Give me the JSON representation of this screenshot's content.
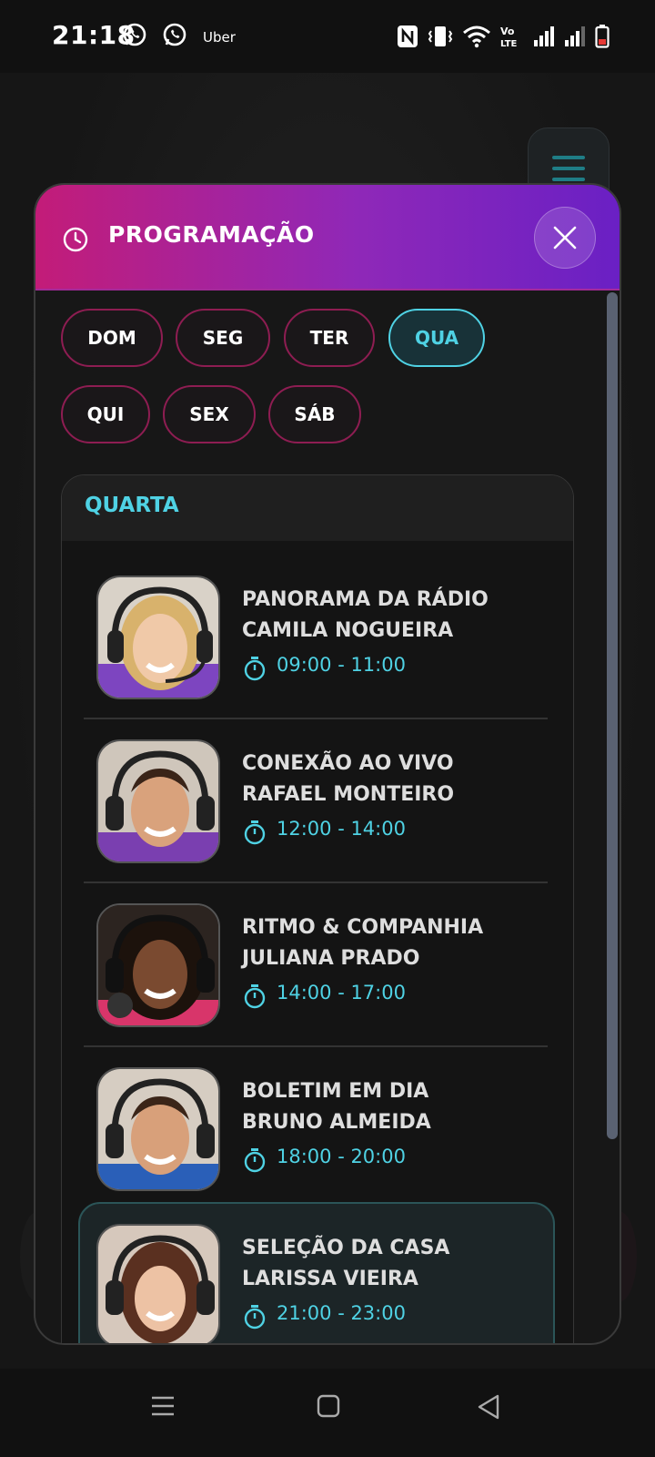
{
  "status_bar": {
    "time": "21:18",
    "notifications": [
      "whatsapp-icon",
      "whatsapp-icon",
      "Uber"
    ],
    "uber_label": "Uber",
    "right_icons": [
      "nfc-icon",
      "vibrate-icon",
      "wifi-icon",
      "volte-icon",
      "signal-icon",
      "signal-icon",
      "battery-icon"
    ],
    "volte_label": "Vo LTE"
  },
  "modal": {
    "title": "PROGRAMAÇÃO",
    "days": [
      {
        "label": "DOM",
        "active": false
      },
      {
        "label": "SEG",
        "active": false
      },
      {
        "label": "TER",
        "active": false
      },
      {
        "label": "QUA",
        "active": true
      },
      {
        "label": "QUI",
        "active": false
      },
      {
        "label": "SEX",
        "active": false
      },
      {
        "label": "SÁB",
        "active": false
      }
    ],
    "schedule_title": "QUARTA",
    "shows": [
      {
        "show": "PANORAMA DA RÁDIO",
        "host": "CAMILA NOGUEIRA",
        "time": "09:00 - 11:00"
      },
      {
        "show": "CONEXÃO AO VIVO",
        "host": "RAFAEL MONTEIRO",
        "time": "12:00 - 14:00"
      },
      {
        "show": "RITMO & COMPANHIA",
        "host": "JULIANA PRADO",
        "time": "14:00 - 17:00"
      },
      {
        "show": "BOLETIM EM DIA",
        "host": "BRUNO ALMEIDA",
        "time": "18:00 - 20:00"
      },
      {
        "show": "SELEÇÃO DA CASA",
        "host": "LARISSA VIEIRA",
        "time": "21:00 - 23:00"
      }
    ]
  },
  "colors": {
    "accent": "#4fd2e4",
    "header_gradient_start": "#c31c78",
    "header_gradient_end": "#6a20c4",
    "chip_border": "#8e1d52"
  }
}
